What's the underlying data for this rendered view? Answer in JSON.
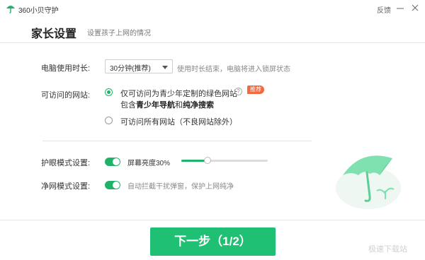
{
  "window": {
    "title": "360小贝守护",
    "feedback_label": "反馈"
  },
  "header": {
    "title": "家长设置",
    "subtitle": "设置孩子上网的情况"
  },
  "computer_time": {
    "label": "电脑使用时长:",
    "selected_value": "30分钟(推荐)",
    "hint": "使用时长结束，电脑将进入锁屏状态"
  },
  "websites": {
    "label": "可访问的网站:",
    "options": [
      {
        "line1": "仅可访问为青少年定制的绿色网站",
        "line2_prefix": "包含",
        "line2_bold1": "青少年导航",
        "line2_mid": "和",
        "line2_bold2": "纯净搜索",
        "badge": "推荐",
        "selected": true
      },
      {
        "line1": "可访问所有网站（不良网站除外）",
        "selected": false
      }
    ]
  },
  "eye_mode": {
    "label": "护眼模式设置:",
    "enabled": true,
    "brightness_label": "屏幕亮度30%",
    "brightness_level": 0.3
  },
  "net_mode": {
    "label": "净网模式设置:",
    "enabled": true,
    "hint": "自动拦截干扰弹窗，保护上网纯净"
  },
  "footer": {
    "next_label": "下一步（1/2）",
    "watermark": "极速下载站"
  },
  "colors": {
    "accent": "#21b26a",
    "button": "#1fbf74",
    "badge": "#f26a3d"
  },
  "icons": {
    "app": "umbrella-logo-icon",
    "minimize": "minimize-icon",
    "close": "close-icon",
    "help": "question-icon",
    "illustration": "umbrella-illustration-icon"
  }
}
